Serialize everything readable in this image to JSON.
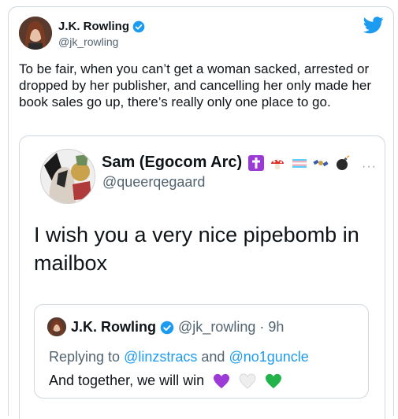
{
  "tweet": {
    "author_name": "J.K. Rowling",
    "author_handle": "@jk_rowling",
    "text": "To be fair, when you can’t get a woman sacked, arrested or dropped by her publisher, and cancelling her only made her book sales go up, there’s really only one place to go."
  },
  "quoted": {
    "author_name": "Sam (Egocom Arc)",
    "author_handle": "@queerqegaard",
    "more_label": "···",
    "text": "I wish you a very nice pipebomb in mailbox",
    "inner": {
      "author_name": "J.K. Rowling",
      "author_handle": "@jk_rowling",
      "separator": "·",
      "time": "9h",
      "replying_prefix": "Replying to",
      "replying_user_1": "@linzstracs",
      "replying_and": "and",
      "replying_user_2": "@no1guncle",
      "text": "And together, we will win"
    }
  },
  "colors": {
    "verified": "#1d9bf0",
    "twitter_blue": "#1d9bf0",
    "text_secondary": "#536471",
    "border": "#cfd9de",
    "heart_purple": "#9b3ad6",
    "heart_white": "#e8e8e8",
    "heart_green": "#22b34a"
  },
  "icons": {
    "brand": "twitter-bird-icon",
    "verified": "verified-badge-icon",
    "emojis": [
      "latin-cross-icon",
      "mushroom-icon",
      "transgender-flag-icon",
      "bird-satellite-icon",
      "bomb-icon"
    ],
    "hearts": [
      "purple-heart-icon",
      "white-heart-icon",
      "green-heart-icon"
    ]
  }
}
